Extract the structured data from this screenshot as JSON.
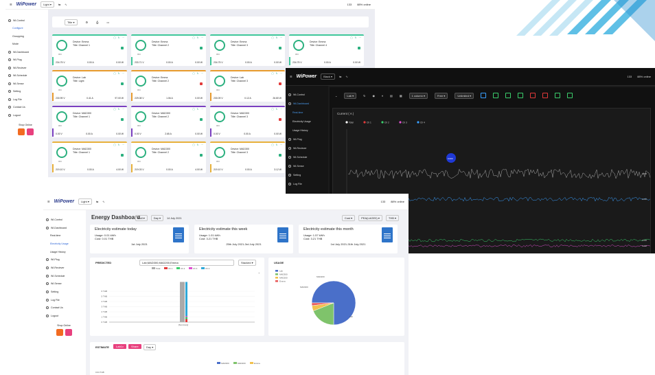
{
  "common": {
    "brand": "WiPower",
    "online": "88% online",
    "count": "133",
    "theme_light": "Light",
    "theme_dark": "Black",
    "sidebar": {
      "control": "Wi-Control",
      "configure": "Configure",
      "groupping": "Groupping",
      "mode": "Mode",
      "dashboard": "Wi-Dashboard",
      "realtime": "Real-time",
      "electricity": "Electricity Usage",
      "usage_history": "Usage History",
      "plug": "Wi-Plug",
      "reciever": "Wi-Reciever",
      "schedule": "Wi-Schedule",
      "sense": "Wi-Sense",
      "setting": "Setting",
      "log": "Log File",
      "contact": "Contact Us",
      "logout": "Logout",
      "shop": "Shop Online"
    }
  },
  "s1": {
    "filter_label": "Title",
    "cards": [
      {
        "device": "Device: Emma",
        "title": "Title: Channel 1",
        "state": "ON",
        "v": "234.75 V",
        "a": "0.00 A",
        "w": "0.00 W",
        "accent": "#3ec79a",
        "lock": "green"
      },
      {
        "device": "Device: Emma",
        "title": "Title: Channel 2",
        "state": "ON",
        "v": "233.71 V",
        "a": "0.00 A",
        "w": "0.00 W",
        "accent": "#3ec79a",
        "lock": "green"
      },
      {
        "device": "Device: Emma",
        "title": "Title: Channel 3",
        "state": "ON",
        "v": "234.75 V",
        "a": "0.00 A",
        "w": "0.00 W",
        "accent": "#3ec79a",
        "lock": "green"
      },
      {
        "device": "Device: Emma",
        "title": "Title: Channel 4",
        "state": "ON",
        "v": "234.75 V",
        "a": "0.00 A",
        "w": "0.00 W",
        "accent": "#3ec79a",
        "lock": "green"
      },
      {
        "device": "Device: Lab",
        "title": "Title: Light",
        "state": "ON",
        "v": "230.99 V",
        "a": "0.41 A",
        "w": "97.00 W",
        "accent": "#e89a2c",
        "lock": "green"
      },
      {
        "device": "Device: Emma",
        "title": "Title: Channel 2",
        "state": "ON",
        "v": "229.08 V",
        "a": "1.06 A",
        "w": "0.00 W",
        "accent": "#e89a2c",
        "lock": "red"
      },
      {
        "device": "Device: Lab",
        "title": "Title: Channel 3",
        "state": "ON",
        "v": "230.09 V",
        "a": "0.12 A",
        "w": "26.80 W",
        "accent": "#e89a2c",
        "lock": "red"
      },
      {
        "device": "Device: Lab",
        "title": "Title: Channel 4",
        "state": "ON",
        "v": "0.00 V",
        "a": "0.00 A",
        "w": "0.00 W",
        "accent": "#e89a2c",
        "lock": "green"
      },
      {
        "device": "Device: MAD300",
        "title": "Title: Channel 1",
        "state": "ON",
        "v": "0.00 V",
        "a": "0.00 A",
        "w": "0.00 W",
        "accent": "#7a3fc0",
        "lock": "green"
      },
      {
        "device": "Device: MAD300",
        "title": "Title: Channel 2",
        "state": "ON",
        "v": "0.00 V",
        "a": "2.65 A",
        "w": "0.00 W",
        "accent": "#7a3fc0",
        "lock": "green"
      },
      {
        "device": "Device: MAD300",
        "title": "Title: Channel 3",
        "state": "ON",
        "v": "0.00 V",
        "a": "0.00 A",
        "w": "0.00 W",
        "accent": "#7a3fc0",
        "lock": "red"
      },
      {
        "device": "Device: MAD300",
        "title": "Title: Channel 4",
        "state": "ON",
        "v": "0.00 V",
        "a": "0.00 A",
        "w": "0.00 W",
        "accent": "#7a3fc0",
        "lock": "green"
      },
      {
        "device": "Device: MAD300",
        "title": "Title: Channel 1",
        "state": "ON",
        "v": "219.10 V",
        "a": "0.00 A",
        "w": "4.00 W",
        "accent": "#e8b13a",
        "lock": "green"
      },
      {
        "device": "Device: MAD300",
        "title": "Title: Channel 2",
        "state": "ON",
        "v": "219.03 V",
        "a": "0.00 A",
        "w": "4.00 W",
        "accent": "#e8b13a",
        "lock": "green"
      },
      {
        "device": "Device: MAD300",
        "title": "Title: Channel 3",
        "state": "ON",
        "v": "219.10 V",
        "a": "0.00 A",
        "w": "3.12 W",
        "accent": "#e8b13a",
        "lock": "green"
      }
    ]
  },
  "s2": {
    "device": "Lab",
    "columns": "1 column",
    "scale": "Free",
    "range": "Unlimited",
    "panel_title": "Current ( A )",
    "marker": "0.000",
    "legend": [
      {
        "name": "Total",
        "color": "#ffffff"
      },
      {
        "name": "Ch 1",
        "color": "#e23a3a"
      },
      {
        "name": "Ch 2",
        "color": "#3bcf6c"
      },
      {
        "name": "Ch 3",
        "color": "#e04fd0"
      },
      {
        "name": "Ch 4",
        "color": "#3aa0ff"
      }
    ],
    "right_labels": [
      "0.000",
      "0.000",
      "0.000",
      "0.000"
    ],
    "times": [
      "10:59:45.76",
      "10:59:58.13",
      "10:59:48.73",
      "10:59:56.11",
      "10:59:51.50",
      "10:59:53.38",
      "10:59:55.12",
      "10:59:58.30",
      "10:59:59.89",
      "11:00:00.18",
      "10:59:54.29",
      "10:59:59.70",
      "11:00:00.07",
      "10:59:58.13",
      "10:59:58.63"
    ]
  },
  "s3": {
    "title": "Energy Dashboard",
    "date_ctl": [
      "Pull",
      "Day"
    ],
    "date": "14 July 2021",
    "right_ctl": [
      "Cost",
      "PEA(LAGE0)",
      "THB"
    ],
    "estimates": [
      {
        "title": "Electricity estimate today",
        "usage": "Usage: 0.01 kWh",
        "cost": "Cost: 0.01 THB",
        "date": "1st July 2021"
      },
      {
        "title": "Electricity estimate this week",
        "usage": "Usage: 1.01 kWh",
        "cost": "Cost: 3.21 THB",
        "date": "25th July 2021-3rd July 2021"
      },
      {
        "title": "Electricity estimate this month",
        "usage": "Usage: 1.57 kWh",
        "cost": "Cost: 3.21 THB",
        "date": "1st July 2021-31th July 2021"
      }
    ],
    "predicted": {
      "label": "PREDICTED",
      "device": "Lab,MAD300,MAD200,Emma",
      "stack": "Stacked"
    },
    "usage": {
      "label": "USAGE"
    },
    "estimate": {
      "label": "ESTIMATE",
      "b1": "Lab1v",
      "b2": "Share",
      "sel": "Day"
    }
  },
  "chart_data": [
    {
      "type": "bar",
      "categories": [
        "[Summary]"
      ],
      "series": [
        {
          "name": "Total",
          "values": [
            7.8
          ],
          "color": "#aaaaaa"
        },
        {
          "name": "Ch 1",
          "values": [
            0.6
          ],
          "color": "#e23a3a"
        },
        {
          "name": "Ch 2",
          "values": [
            0.4
          ],
          "color": "#3bcf6c"
        },
        {
          "name": "Ch 3",
          "values": [
            0.2
          ],
          "color": "#e04fd0"
        },
        {
          "name": "Ch 4",
          "values": [
            6.6
          ],
          "color": "#2ea8d8"
        }
      ],
      "yticks": [
        "0 THB",
        "1 THB",
        "2 THB",
        "3 THB",
        "4 THB",
        "5 THB",
        "6 THB"
      ],
      "ylim": [
        0,
        8
      ]
    },
    {
      "type": "pie",
      "categories": [
        "Lab",
        "MAD300",
        "MAD200",
        "Emma"
      ],
      "values": [
        75,
        19,
        4,
        2
      ],
      "colors": [
        "#4a6fc9",
        "#7fc36b",
        "#f2c14e",
        "#e85b5b"
      ]
    },
    {
      "type": "bar",
      "categories": [
        "1",
        "2",
        "3",
        "4",
        "5",
        "6",
        "7",
        "8",
        "9",
        "10",
        "11",
        "12",
        "13",
        "14"
      ],
      "series": [
        {
          "name": "MAD300",
          "values": [
            4,
            4,
            4,
            4,
            4,
            4,
            4,
            4,
            4,
            4,
            4,
            4,
            4,
            4
          ],
          "color": "#4a6fc9"
        },
        {
          "name": "MAD200",
          "values": [
            0,
            0,
            0,
            0,
            0,
            0,
            0,
            0,
            0,
            0,
            0,
            0,
            0,
            0
          ],
          "color": "#7fc36b"
        },
        {
          "name": "Emma",
          "values": [
            0,
            0,
            0,
            0,
            0,
            0,
            0,
            0,
            0,
            0,
            0,
            0,
            0,
            0
          ],
          "color": "#f2c14e"
        }
      ],
      "yticks": [
        "0.04 THB"
      ]
    }
  ]
}
